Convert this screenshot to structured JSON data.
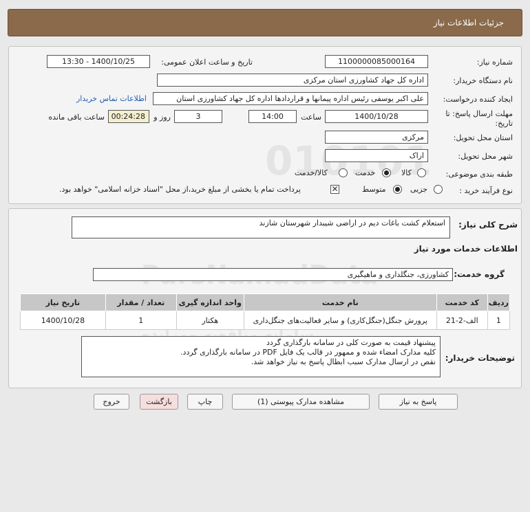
{
  "header": {
    "title": "جزئیات اطلاعات نیاز"
  },
  "form": {
    "need_number_label": "شماره نیاز:",
    "need_number": "1100000085000164",
    "announce_label": "تاریخ و ساعت اعلان عمومی:",
    "announce_value": "1400/10/25 - 13:30",
    "buyer_org_label": "نام دستگاه خریدار:",
    "buyer_org": "اداره کل جهاد کشاورزی استان مرکزی",
    "creator_label": "ایجاد کننده درخواست:",
    "creator": "علی اکبر یوسفی رئیس اداره پیمانها و قراردادها اداره کل جهاد کشاورزی استان",
    "contact_link": "اطلاعات تماس خریدار",
    "deadline_label_1": "مهلت ارسال پاسخ: تا",
    "deadline_label_2": "تاریخ:",
    "deadline_date": "1400/10/28",
    "time_label": "ساعت",
    "deadline_time": "14:00",
    "days_value": "3",
    "days_label": "روز و",
    "remaining_time": "00:24:28",
    "remaining_label": "ساعت باقی مانده",
    "province_label": "استان محل تحویل:",
    "province": "مرکزی",
    "city_label": "شهر محل تحویل:",
    "city": "اراک",
    "category_label": "طبقه بندی موضوعی:",
    "category_options": [
      "کالا",
      "خدمت",
      "کالا/خدمت"
    ],
    "category_selected": "خدمت",
    "process_label": "نوع فرآیند خرید :",
    "process_options": [
      "جزیی",
      "متوسط"
    ],
    "process_selected": "متوسط",
    "payment_note": "پرداخت تمام یا بخشی از مبلغ خرید،از محل \"اسناد خزانه اسلامی\" خواهد بود."
  },
  "details": {
    "need_desc_label": "شرح کلی نیاز:",
    "need_desc": "استعلام کشت باغات  دیم در اراضی شیبدار شهرستان شازند",
    "services_heading": "اطلاعات خدمات مورد نیاز",
    "service_group_label": "گروه خدمت:",
    "service_group": "کشاورزی، جنگلداری و ماهیگیری",
    "table": {
      "headers": [
        "ردیف",
        "کد خدمت",
        "نام خدمت",
        "واحد اندازه گیری",
        "تعداد / مقدار",
        "تاریخ نیاز"
      ],
      "rows": [
        [
          "1",
          "الف-2-21",
          "پرورش جنگل(جنگل‌کاری) و سایر فعالیت‌های جنگل‌داری",
          "هکتار",
          "1",
          "1400/10/28"
        ]
      ]
    },
    "buyer_desc_label": "توضیحات خریدار:",
    "buyer_desc_lines": [
      "پیشنهاد قیمت به صورت کلی در سامانه بارگذاری گردد",
      "کلیه مدارک امضاء شده و ممهور در قالب یک فایل PDF  در سامانه بارگذاری گردد.",
      "نقص در ارسال مدارک سبب ابطال پاسخ به نیاز خواهد شد."
    ]
  },
  "buttons": {
    "reply": "پاسخ به نیاز",
    "attachments": "مشاهده مدارک پیوستی (1)",
    "print": "چاپ",
    "back": "بازگشت",
    "exit": "خروج"
  },
  "watermark": {
    "digits": "010101",
    "brand": "ParsNamadData",
    "tagline": "مرکز فراوری اطلاعات پارس نماد داده",
    "tagline2": "سامانه مناقصه ومزایده",
    "phone": "۰۲۱-۸۸۳۴۹۶۷۰"
  }
}
